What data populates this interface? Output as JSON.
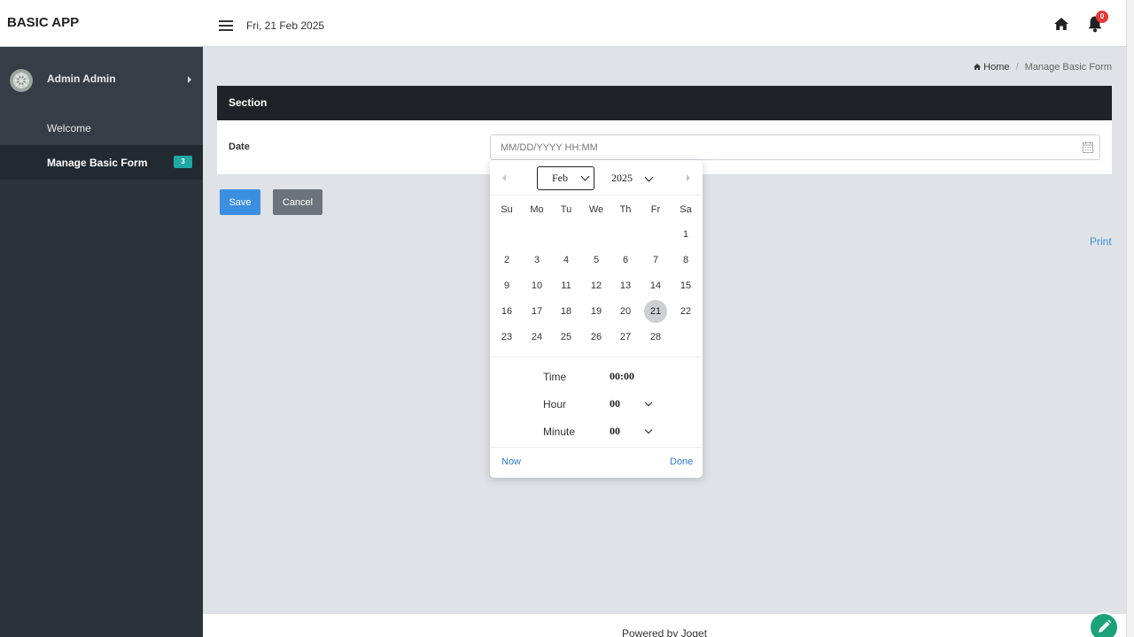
{
  "header": {
    "brand": "BASIC APP",
    "date": "Fri, 21 Feb 2025",
    "notification_count": "0"
  },
  "sidebar": {
    "user_name": "Admin Admin",
    "items": [
      {
        "label": "Welcome"
      },
      {
        "label": "Manage Basic Form",
        "badge": "3"
      }
    ]
  },
  "breadcrumb": {
    "home": "Home",
    "separator": "/",
    "current": "Manage Basic Form"
  },
  "form": {
    "section_title": "Section",
    "date_label": "Date",
    "date_placeholder": "MM/DD/YYYY HH:MM",
    "save_label": "Save",
    "cancel_label": "Cancel",
    "print_label": "Print"
  },
  "datepicker": {
    "month": "Feb",
    "year": "2025",
    "weekdays": [
      "Su",
      "Mo",
      "Tu",
      "We",
      "Th",
      "Fr",
      "Sa"
    ],
    "first_weekday_index": 6,
    "days_in_month": 28,
    "selected_day": 21,
    "time_label": "Time",
    "time_value": "00:00",
    "hour_label": "Hour",
    "hour_value": "00",
    "minute_label": "Minute",
    "minute_value": "00",
    "now_label": "Now",
    "done_label": "Done"
  },
  "footer": {
    "text": "Powered by Joget"
  },
  "colors": {
    "accent": "#3b8fe0",
    "sidebar_bg": "#2b333b",
    "section_header_bg": "#1f2327",
    "badge_teal": "#1fa8a5",
    "notification_red": "#e53935",
    "edit_fab": "#1aa37a"
  },
  "icons": {
    "menu": "hamburger-menu-icon",
    "home": "home-icon",
    "notifications": "bell-icon",
    "calendar": "calendar-icon",
    "edit": "pencil-icon"
  }
}
